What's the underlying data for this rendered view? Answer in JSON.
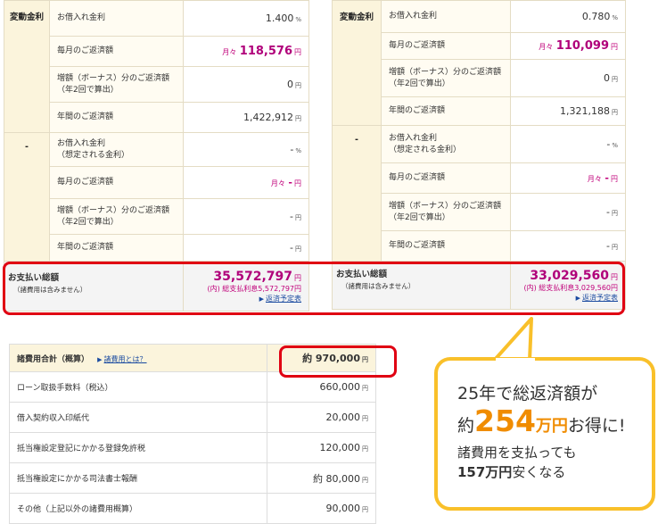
{
  "left": {
    "cat_variable": "変動金利",
    "cat_dash": "-",
    "rate_label": "お借入れ金利",
    "rate_value": "1.400",
    "rate_unit": "%",
    "monthly_label": "毎月のご返済額",
    "monthly_prefix": "月々",
    "monthly_value": "118,576",
    "yen": "円",
    "bonus_label": "増額（ボーナス）分のご返済額",
    "bonus_sub": "（年2回で算出）",
    "bonus_value": "0",
    "annual_label": "年間のご返済額",
    "annual_value": "1,422,912",
    "rate2_label": "お借入れ金利",
    "rate2_sub": "（想定される金利）",
    "rate2_value": "-",
    "monthly2_prefix": "月々",
    "monthly2_value": "-",
    "bonus2_value": "-",
    "annual2_value": "-",
    "total_label": "お支払い総額",
    "total_sub": "（諸費用は含みません）",
    "total_value": "35,572,797",
    "total_interest": "(内) 総支払利息5,572,797円",
    "schedule_link": "返済予定表"
  },
  "right": {
    "cat_variable": "変動金利",
    "cat_dash": "-",
    "rate_value": "0.780",
    "monthly_value": "110,099",
    "bonus_value": "0",
    "annual_value": "1,321,188",
    "total_value": "33,029,560",
    "total_interest": "(内) 総支払利息3,029,560円",
    "schedule_link": "返済予定表"
  },
  "fees": {
    "head_label": "諸費用合計（概算）",
    "head_link": "諸費用とは？",
    "head_value": "約 970,000",
    "rows": [
      {
        "label": "ローン取扱手数料（税込）",
        "value": "660,000"
      },
      {
        "label": "借入契約収入印紙代",
        "value": "20,000"
      },
      {
        "label": "抵当権設定登記にかかる登録免許税",
        "value": "120,000"
      },
      {
        "label": "抵当権設定にかかる司法書士報酬",
        "value": "約 80,000"
      },
      {
        "label": "その他（上記以外の諸費用概算）",
        "value": "90,000"
      }
    ]
  },
  "bubble": {
    "line1": "25年で総返済額が",
    "line2_pre": "約",
    "line2_num": "254",
    "line2_unit": "万円",
    "line2_post": "お得に!",
    "line3": "諸費用を支払っても",
    "line4_bold": "157万円",
    "line4_post": "安くなる"
  },
  "colors": {
    "accent": "#b0007a",
    "highlight": "#e00012",
    "bubble_border": "#f9c02a",
    "bubble_text": "#f08c00"
  }
}
